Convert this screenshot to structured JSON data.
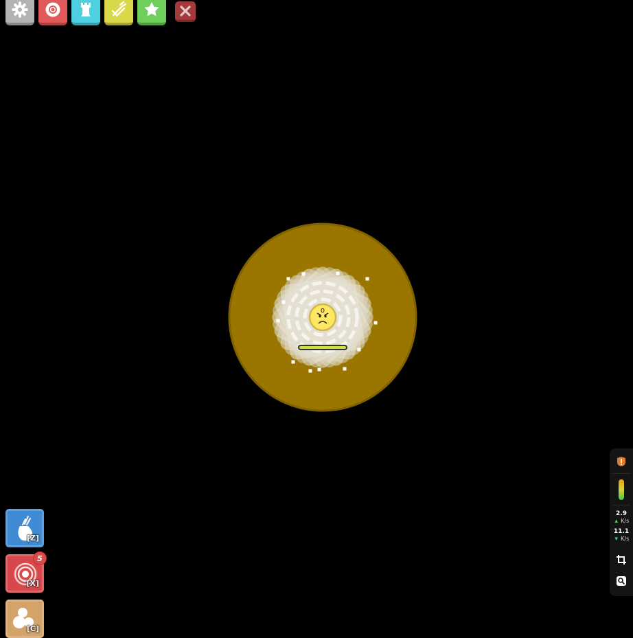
{
  "toolbar": {
    "buttons": [
      {
        "name": "settings",
        "icon": "gear-icon",
        "color": "#b3b3b3"
      },
      {
        "name": "petals",
        "icon": "flower-ring-icon",
        "color": "#e05a5a"
      },
      {
        "name": "inventory",
        "icon": "tower-icon",
        "color": "#4fd0e0"
      },
      {
        "name": "craft",
        "icon": "crafting-icon",
        "color": "#d8d84a"
      },
      {
        "name": "achievements",
        "icon": "star-icon",
        "color": "#6ed05a"
      }
    ],
    "close_icon": "close-icon"
  },
  "player": {
    "ring_color": "#9a7600",
    "body_color": "#ffe763",
    "health_fraction": 1.0,
    "expression": "angry-worried"
  },
  "abilities": [
    {
      "key": "[Z]",
      "icon": "drop-bag-icon",
      "color": "#3f8bd4"
    },
    {
      "key": "[X]",
      "icon": "swirl-icon",
      "color": "#d8474c",
      "count": "5"
    },
    {
      "key": "[C]",
      "icon": "orbs-icon",
      "color": "#d3a36a"
    }
  ],
  "network": {
    "warning_icon": "warning-shield-icon",
    "signal_icon": "signal-meter-icon",
    "upload_value": "2.9",
    "upload_unit": "K/s",
    "download_value": "11.1",
    "download_unit": "K/s",
    "crop_icon": "crop-icon",
    "zoom_icon": "zoom-icon"
  }
}
